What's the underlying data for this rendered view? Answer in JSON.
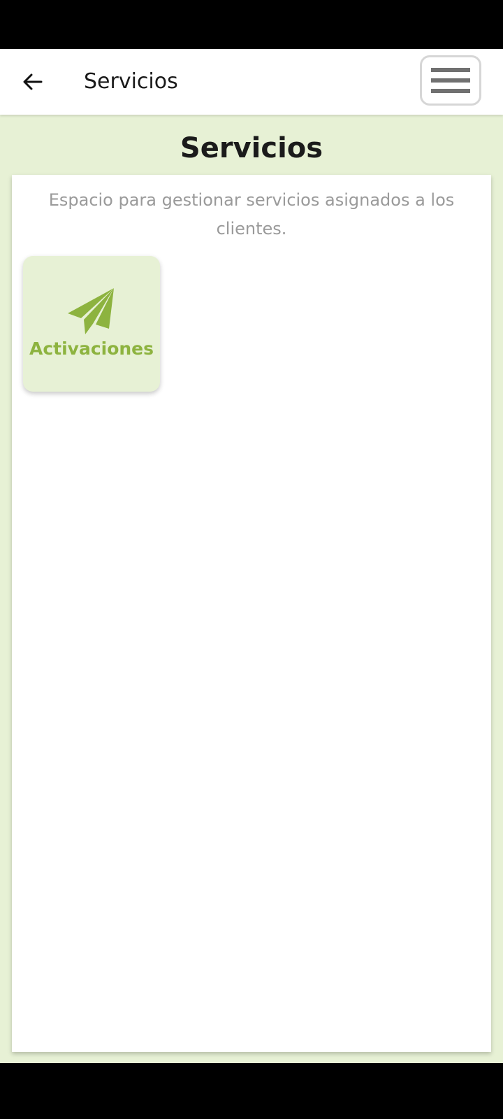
{
  "app_bar": {
    "title": "Servicios"
  },
  "page": {
    "heading": "Servicios",
    "description": "Espacio para gestionar servicios asignados a los clientes."
  },
  "services": [
    {
      "label": "Activaciones",
      "icon": "paper-plane-icon"
    }
  ],
  "colors": {
    "accent": "#8db33f",
    "background": "#e7f1d5",
    "card": "#ffffff",
    "muted_text": "#9a9a9a"
  }
}
